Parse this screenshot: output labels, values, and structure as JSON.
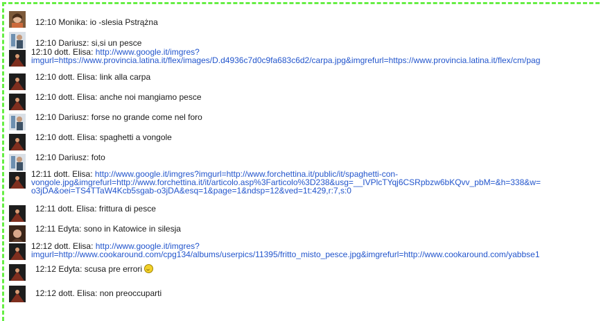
{
  "messages": [
    {
      "avatar": "monika-avatar",
      "time": "12:10",
      "sender": "Monika",
      "text": "io -slesia Pstrążna",
      "lines": null
    },
    {
      "avatar": "dariusz-avatar",
      "time": "12:10",
      "sender": "Dariusz",
      "text": "si,si un pesce",
      "lines": null
    },
    {
      "avatar": "elisa-avatar",
      "time": "12:10",
      "sender": "dott. Elisa",
      "text": null,
      "lines": [
        "http://www.google.it/imgres?",
        "imgurl=https://www.provincia.latina.it/flex/images/D.d4936c7d0c9fa683c6d2/carpa.jpg&imgrefurl=https://www.provincia.latina.it/flex/cm/pag"
      ]
    },
    {
      "avatar": "elisa-avatar",
      "time": "12:10",
      "sender": "dott. Elisa",
      "text": "link alla carpa",
      "lines": null
    },
    {
      "avatar": "elisa-avatar",
      "time": "12:10",
      "sender": "dott. Elisa",
      "text": "anche noi mangiamo pesce",
      "lines": null
    },
    {
      "avatar": "dariusz-avatar",
      "time": "12:10",
      "sender": "Dariusz",
      "text": "forse no grande come nel foro",
      "lines": null
    },
    {
      "avatar": "elisa-avatar",
      "time": "12:10",
      "sender": "dott. Elisa",
      "text": "spaghetti a vongole",
      "lines": null
    },
    {
      "avatar": "dariusz-avatar",
      "time": "12:10",
      "sender": "Dariusz",
      "text": "foto",
      "lines": null
    },
    {
      "avatar": "elisa-avatar",
      "time": "12:11",
      "sender": "dott. Elisa",
      "text": null,
      "lines": [
        "http://www.google.it/imgres?imgurl=http://www.forchettina.it/public/it/spaghetti-con-",
        "vongole.jpg&imgrefurl=http://www.forchettina.it/it/articolo.asp%3Farticolo%3D238&usg=__IVPlcTYqj6CSRpbzw6bKQvv_pbM=&h=338&w=",
        "o3jDA&oei=TS4TTaW4Kcb5sgab-o3jDA&esq=1&page=1&ndsp=12&ved=1t:429,r:7,s:0"
      ]
    },
    {
      "avatar": "elisa-avatar",
      "time": "12:11",
      "sender": "dott. Elisa",
      "text": "frittura di pesce",
      "lines": null
    },
    {
      "avatar": "edyta-avatar",
      "time": "12:11",
      "sender": "Edyta",
      "text": "sono in Katowice in silesja",
      "lines": null
    },
    {
      "avatar": "elisa-avatar",
      "time": "12:12",
      "sender": "dott. Elisa",
      "text": null,
      "lines": [
        "http://www.google.it/imgres?",
        "imgurl=http://www.cookaround.com/cpg134/albums/userpics/11395/fritto_misto_pesce.jpg&imgrefurl=http://www.cookaround.com/yabbse1"
      ]
    },
    {
      "avatar": "elisa-avatar",
      "time": "12:12",
      "sender": "Edyta",
      "text": "scusa pre errori",
      "lines": null,
      "smiley": true
    },
    {
      "avatar": "elisa-avatar",
      "time": "12:12",
      "sender": "dott. Elisa",
      "text": "non preoccuparti",
      "lines": null
    }
  ]
}
